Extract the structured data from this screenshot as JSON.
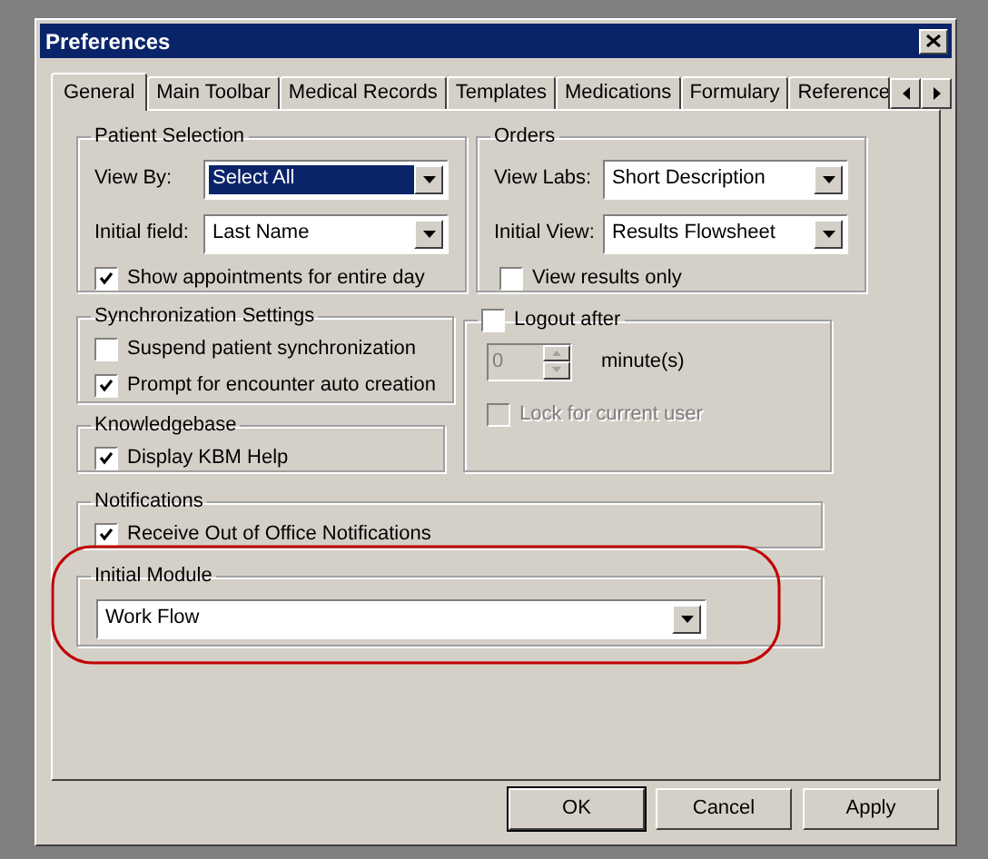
{
  "window": {
    "title": "Preferences"
  },
  "tabs": [
    {
      "label": "General",
      "selected": true
    },
    {
      "label": "Main Toolbar",
      "selected": false
    },
    {
      "label": "Medical Records",
      "selected": false
    },
    {
      "label": "Templates",
      "selected": false
    },
    {
      "label": "Medications",
      "selected": false
    },
    {
      "label": "Formulary",
      "selected": false
    },
    {
      "label": "Reference",
      "selected": false
    }
  ],
  "patient_selection": {
    "title": "Patient Selection",
    "fields": [
      {
        "label": "View By:",
        "value": "Select All",
        "highlighted": true
      },
      {
        "label": "Initial field:",
        "value": "Last Name",
        "highlighted": false
      }
    ],
    "checkbox": {
      "label": "Show appointments for entire day",
      "checked": true,
      "disabled": false
    }
  },
  "orders": {
    "title": "Orders",
    "fields": [
      {
        "label": "View Labs:",
        "value": "Short Description",
        "highlighted": false
      },
      {
        "label": "Initial View:",
        "value": "Results Flowsheet",
        "highlighted": false
      }
    ],
    "checkbox": {
      "label": "View results only",
      "checked": false,
      "disabled": false
    }
  },
  "synchronization": {
    "title": "Synchronization Settings",
    "checkboxes": [
      {
        "label": "Suspend patient synchronization",
        "checked": false,
        "disabled": false
      },
      {
        "label": "Prompt for encounter auto creation",
        "checked": true,
        "disabled": false
      }
    ]
  },
  "logout": {
    "checkbox": {
      "label": "Logout after",
      "checked": false,
      "disabled": false
    },
    "spinner": {
      "value": "0",
      "disabled": true
    },
    "unit": "minute(s)",
    "lock": {
      "label": "Lock for current user",
      "checked": false,
      "disabled": true
    }
  },
  "knowledgebase": {
    "title": "Knowledgebase",
    "checkbox": {
      "label": "Display KBM Help",
      "checked": true,
      "disabled": false
    }
  },
  "notifications": {
    "title": "Notifications",
    "checkbox": {
      "label": "Receive Out of Office Notifications",
      "checked": true,
      "disabled": false
    }
  },
  "initial_module": {
    "title": "Initial Module",
    "value": "Work Flow",
    "highlighted": false
  },
  "buttons": [
    {
      "label": "OK",
      "default": true
    },
    {
      "label": "Cancel",
      "default": false
    },
    {
      "label": "Apply",
      "default": false
    }
  ]
}
